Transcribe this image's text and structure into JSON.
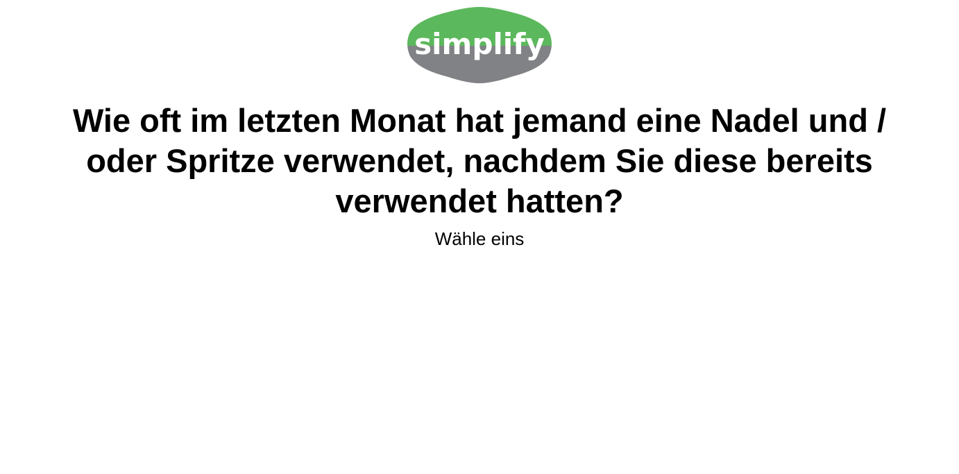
{
  "logo": {
    "text": "simplify",
    "colors": {
      "top": "#5cb85c",
      "bottom": "#808285",
      "text": "#ffffff"
    }
  },
  "question": {
    "text": "Wie oft im letzten Monat hat jemand eine Nadel und / oder Spritze verwendet, nachdem Sie diese bereits verwendet hatten?"
  },
  "instruction": {
    "text": "Wähle eins"
  },
  "colors": {
    "background": "#ffffff",
    "text": "#000000"
  }
}
